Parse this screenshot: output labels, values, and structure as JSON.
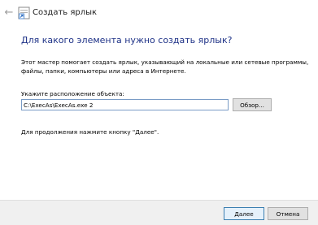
{
  "window": {
    "title": "Создать ярлык",
    "back_icon": "back-arrow-icon",
    "app_icon": "shortcut-icon"
  },
  "main": {
    "heading": "Для какого элемента нужно создать ярлык?",
    "description_line1": "Этот мастер помогает создать ярлык, указывающий на локальные или сетевые программы,",
    "description_line2": "файлы, папки, компьютеры или адреса в Интернете.",
    "location_label": "Укажите расположение объекта:",
    "location_value": "C:\\ExecAs\\ExecAs.exe 2",
    "browse_label": "Обзор...",
    "hint": "Для продолжения нажмите кнопку \"Далее\"."
  },
  "footer": {
    "next_label": "Далее",
    "cancel_label": "Отмена"
  },
  "colors": {
    "heading": "#1e3287",
    "footer_bg": "#f0f0f0",
    "input_border": "#7a9cc6",
    "default_button_border": "#3c7fb1"
  }
}
